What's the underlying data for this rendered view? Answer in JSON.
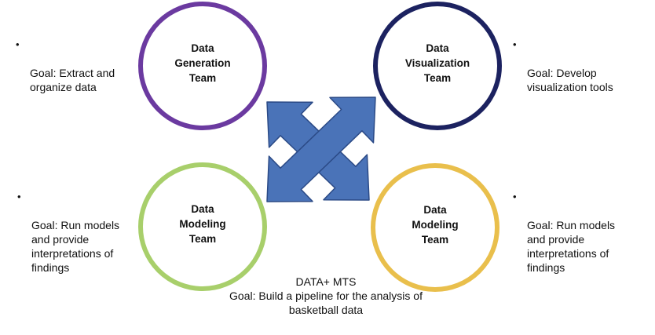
{
  "teams": {
    "top_left": {
      "name": "Data\nGeneration\nTeam",
      "color": "#6b3aa0",
      "goal": "Goal: Extract and\norganize data"
    },
    "top_right": {
      "name": "Data\nVisualization\nTeam",
      "color": "#1c2260",
      "goal": "Goal: Develop\nvisualization tools"
    },
    "bottom_left": {
      "name": "Data\nModeling\nTeam",
      "color": "#a8cf6b",
      "goal": "Goal: Run models\nand provide\ninterpretations of\nfindings"
    },
    "bottom_right": {
      "name": "Data\nModeling\nTeam",
      "color": "#e9bf4c",
      "goal": "Goal: Run models\nand provide\ninterpretations of\nfindings"
    }
  },
  "center_arrows": {
    "icon": "four-way-arrow-icon",
    "fill_color": "#4a73b8",
    "stroke_color": "#2b4a86"
  },
  "footer": {
    "line1": "DATA+ MTS",
    "line2": "Goal: Build a pipeline for the analysis of",
    "line3": "basketball data"
  },
  "bullet_glyph": "•"
}
